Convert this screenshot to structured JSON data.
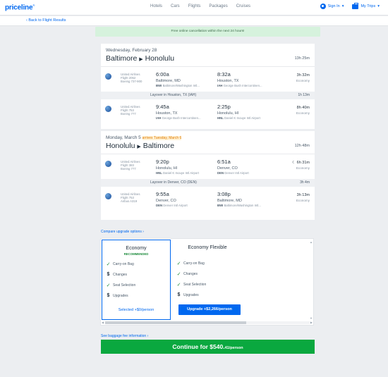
{
  "header": {
    "logo": "priceline",
    "nav": [
      "Hotels",
      "Cars",
      "Flights",
      "Packages",
      "Cruises"
    ],
    "sign_in": "Sign In",
    "my_trips": "My Trips"
  },
  "back_link": "Back to Flight Results",
  "banner": "Free online cancellation within the next 24 hours!",
  "outbound": {
    "date": "Wednesday, February 28",
    "origin": "Baltimore",
    "destination": "Honolulu",
    "duration": "13h 25m",
    "segments": [
      {
        "airline": "United Airlines",
        "flight": "Flight 2052",
        "aircraft": "Boeing 737-900",
        "dep_time": "6:00a",
        "dep_city": "Baltimore, MD",
        "dep_code": "BWI",
        "dep_airport": "Baltimore/Washington Intl...",
        "arr_time": "8:32a",
        "arr_city": "Houston, TX",
        "arr_code": "IAH",
        "arr_airport": "George Bush Intercontinen...",
        "duration": "3h 32m",
        "cabin": "Economy"
      },
      {
        "airline": "United Airlines",
        "flight": "Flight 753",
        "aircraft": "Boeing 777",
        "dep_time": "9:45a",
        "dep_city": "Houston, TX",
        "dep_code": "IAH",
        "dep_airport": "George Bush Intercontinen...",
        "arr_time": "2:25p",
        "arr_city": "Honolulu, HI",
        "arr_code": "HNL",
        "arr_airport": "Daniel K Inouye Intl Airport",
        "duration": "8h 40m",
        "cabin": "Economy"
      }
    ],
    "layover": {
      "text": "Layover in Houston, TX (IAH)",
      "duration": "1h 13m"
    }
  },
  "return": {
    "date": "Monday, March 5",
    "arrives_note": "arrives Tuesday, March 6",
    "origin": "Honolulu",
    "destination": "Baltimore",
    "duration": "12h 48m",
    "segments": [
      {
        "airline": "United Airlines",
        "flight": "Flight 383",
        "aircraft": "Boeing 777",
        "dep_time": "9:20p",
        "dep_city": "Honolulu, HI",
        "dep_code": "HNL",
        "dep_airport": "Daniel K Inouye Intl Airport",
        "arr_time": "6:51a",
        "arr_city": "Denver, CO",
        "arr_code": "DEN",
        "arr_airport": "Denver Intl Airport",
        "duration": "6h 31m",
        "cabin": "Economy"
      },
      {
        "airline": "United Airlines",
        "flight": "Flight 753",
        "aircraft": "Airbus A319",
        "dep_time": "9:55a",
        "dep_city": "Denver, CO",
        "dep_code": "DEN",
        "dep_airport": "Denver Intl Airport",
        "arr_time": "3:08p",
        "arr_city": "Baltimore, MD",
        "arr_code": "BWI",
        "arr_airport": "Baltimore/Washington Intl...",
        "duration": "3h 13m",
        "cabin": "Economy"
      }
    ],
    "layover": {
      "text": "Layover in Denver, CO (DEN)",
      "duration": "3h 4m"
    }
  },
  "compare_link": "Compare upgrade options",
  "tiers": [
    {
      "name": "Economy",
      "badge": "RECOMMENDED",
      "features": [
        "Carry-on Bag",
        "Changes",
        "Seat Selection",
        "Upgrades"
      ],
      "feature_icons": [
        "check-icon",
        "dollar-icon",
        "check-icon",
        "dollar-icon"
      ],
      "action": "Selected +$0/person"
    },
    {
      "name": "Economy Flexible",
      "features": [
        "Carry-on Bag",
        "Changes",
        "Seat Selection",
        "Upgrades"
      ],
      "feature_icons": [
        "check-icon",
        "check-icon",
        "check-icon",
        "dollar-icon"
      ],
      "action": "Upgrade +$2,266/person"
    }
  ],
  "baggage_link": "See baggage fee information",
  "continue": {
    "label": "Continue for $540.",
    "cents": "41/person"
  },
  "colors": {
    "brand": "#0068ef",
    "continue": "#0aa83f",
    "banner": "#d6f2dd"
  }
}
